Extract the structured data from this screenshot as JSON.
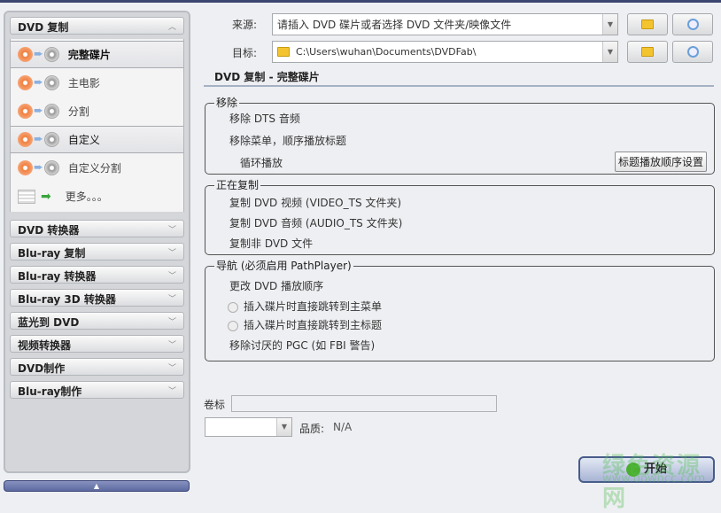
{
  "sidebar": {
    "active_section": "DVD 复制",
    "items": [
      {
        "label": "完整碟片",
        "state": "selected"
      },
      {
        "label": "主电影"
      },
      {
        "label": "分割"
      },
      {
        "label": "自定义",
        "state": "highlighted"
      },
      {
        "label": "自定义分割"
      },
      {
        "label": "更多。。。"
      }
    ],
    "sections": [
      "DVD 转换器",
      "Blu-ray 复制",
      "Blu-ray 转换器",
      "Blu-ray 3D 转换器",
      "蓝光到 DVD",
      "视频转换器",
      "DVD制作",
      "Blu-ray制作"
    ]
  },
  "source": {
    "label": "来源:",
    "value": "请插入 DVD 碟片或者选择 DVD 文件夹/映像文件"
  },
  "target": {
    "label": "目标:",
    "value": "C:\\Users\\wuhan\\Documents\\DVDFab\\"
  },
  "main": {
    "title": "DVD 复制 - 完整碟片",
    "remove": {
      "title": "移除",
      "items": [
        "移除 DTS 音频",
        "移除菜单，顺序播放标题",
        "循环播放"
      ],
      "button": "标题播放顺序设置"
    },
    "copying": {
      "title": "正在复制",
      "items": [
        "复制 DVD 视频 (VIDEO_TS 文件夹)",
        "复制 DVD 音频 (AUDIO_TS 文件夹)",
        "复制非 DVD 文件"
      ]
    },
    "nav": {
      "title": "导航 (必须启用 PathPlayer)",
      "item1": "更改 DVD 播放顺序",
      "radio1": "插入碟片时直接跳转到主菜单",
      "radio2": "插入碟片时直接跳转到主标题",
      "item2": "移除讨厌的 PGC (如 FBI 警告)"
    }
  },
  "volume": {
    "label": "卷标",
    "value": ""
  },
  "quality": {
    "select_value": "",
    "label": "品质:",
    "value": "N/A"
  },
  "start_label": "开始",
  "watermark": {
    "line1": "绿色资源网",
    "line2": "www.downcc.com"
  }
}
